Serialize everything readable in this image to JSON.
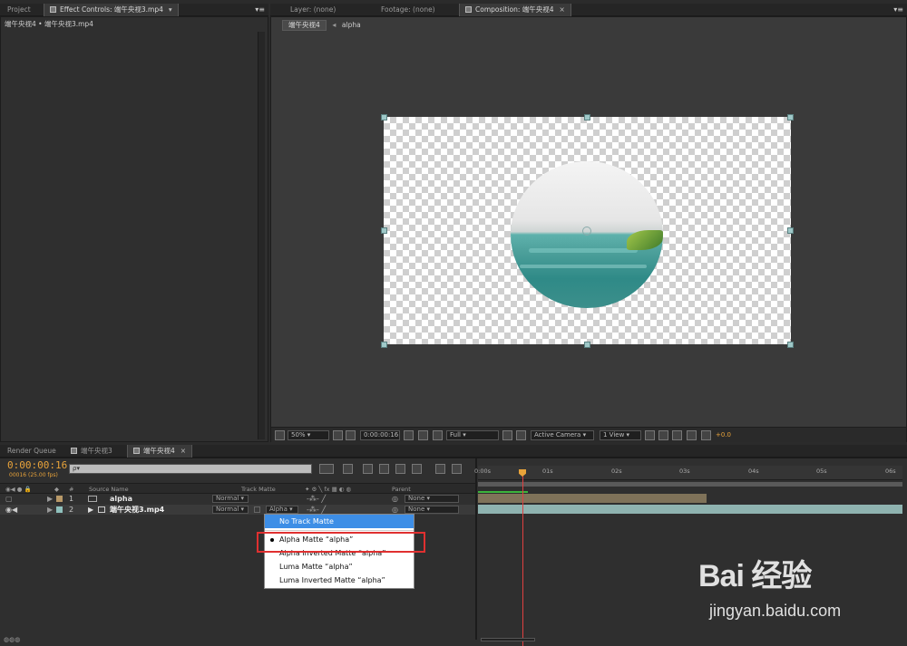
{
  "top_left_tabs": [
    {
      "label": "Project"
    },
    {
      "label": "Effect Controls: 端午央视3.mp4"
    }
  ],
  "effect_controls_breadcrumb": "端午央视4 • 端午央视3.mp4",
  "top_right_tabs": [
    {
      "label": "Layer: (none)"
    },
    {
      "label": "Footage: (none)"
    },
    {
      "label": "Composition: 端午央视4"
    }
  ],
  "comp_breadcrumb": {
    "comp": "端午央视4",
    "layer": "alpha"
  },
  "viewer_controls": {
    "zoom": "50%",
    "timecode": "0:00:00:16",
    "resolution": "Full",
    "camera": "Active Camera",
    "view": "1 View",
    "exposure": "+0.0"
  },
  "bottom_tabs": [
    {
      "label": "Render Queue"
    },
    {
      "label": "端午央视3"
    },
    {
      "label": "端午央视4"
    }
  ],
  "timeline": {
    "timecode": "0:00:00:16",
    "frame_info": "00016 (25.00 fps)",
    "search_placeholder": "ρ▾",
    "columns": {
      "num": "#",
      "source_name": "Source Name",
      "track_matte": "Track Matte",
      "parent": "Parent"
    },
    "layers": [
      {
        "num": "1",
        "name": "alpha",
        "mode": "Normal",
        "track_matte": "",
        "parent": "None",
        "label_color": "#b89968"
      },
      {
        "num": "2",
        "name": "端午央视3.mp4",
        "mode": "Normal",
        "track_matte": "Alpha",
        "parent": "None",
        "label_color": "#8fc1bd"
      }
    ],
    "ruler": [
      "0:00s",
      "01s",
      "02s",
      "03s",
      "04s",
      "05s",
      "06s"
    ],
    "playhead_fraction": 0.107
  },
  "track_matte_menu": {
    "items": [
      {
        "label": "No Track Matte",
        "highlighted": true,
        "checked": false
      },
      {
        "label": "Alpha Matte  “alpha”",
        "highlighted": false,
        "checked": true
      },
      {
        "label": "Alpha Inverted Matte  “alpha”",
        "highlighted": false,
        "checked": false
      },
      {
        "label": "Luma Matte  “alpha”",
        "highlighted": false,
        "checked": false
      },
      {
        "label": "Luma Inverted Matte  “alpha”",
        "highlighted": false,
        "checked": false
      }
    ]
  },
  "watermark": {
    "logo": "Bai 经验",
    "url": "jingyan.baidu.com"
  },
  "colors": {
    "timecode": "#e8a33a",
    "highlight": "#3d8ee6",
    "annotation": "#e03030",
    "playhead": "#e04040",
    "clip_alpha": "#7f7259",
    "clip_video": "#8fb3b0"
  }
}
